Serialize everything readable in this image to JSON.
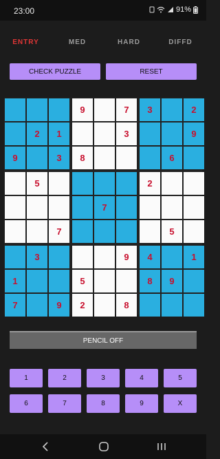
{
  "status_bar": {
    "time": "23:00",
    "battery": "91%"
  },
  "tabs": [
    {
      "label": "ENTRY",
      "active": true
    },
    {
      "label": "MED",
      "active": false
    },
    {
      "label": "HARD",
      "active": false
    },
    {
      "label": "DIFFD",
      "active": false
    }
  ],
  "actions": {
    "check_label": "CHECK PUZZLE",
    "reset_label": "RESET"
  },
  "board": {
    "cells": [
      [
        "",
        "",
        "",
        "9",
        "",
        "7",
        "3",
        "",
        "2"
      ],
      [
        "",
        "2",
        "1",
        "",
        "",
        "3",
        "",
        "",
        "9"
      ],
      [
        "9",
        "",
        "3",
        "8",
        "",
        "",
        "",
        "6",
        ""
      ],
      [
        "",
        "5",
        "",
        "",
        "",
        "",
        "2",
        "",
        ""
      ],
      [
        "",
        "",
        "",
        "",
        "7",
        "",
        "",
        "",
        ""
      ],
      [
        "",
        "",
        "7",
        "",
        "",
        "",
        "",
        "5",
        ""
      ],
      [
        "",
        "3",
        "",
        "",
        "",
        "9",
        "4",
        "",
        "1"
      ],
      [
        "1",
        "",
        "",
        "5",
        "",
        "",
        "8",
        "9",
        ""
      ],
      [
        "7",
        "",
        "9",
        "2",
        "",
        "8",
        "",
        "",
        ""
      ]
    ],
    "colors": {
      "blue": "#2aafe0",
      "white": "#fbfbfb",
      "digit": "#c8102e"
    }
  },
  "pencil": {
    "label": "PENCIL OFF"
  },
  "keypad": {
    "row1": [
      "1",
      "2",
      "3",
      "4",
      "5"
    ],
    "row2": [
      "6",
      "7",
      "8",
      "9",
      "X"
    ]
  },
  "accent_color": "#b68ef8",
  "nav_icons": [
    "back-icon",
    "home-icon",
    "recents-icon"
  ]
}
